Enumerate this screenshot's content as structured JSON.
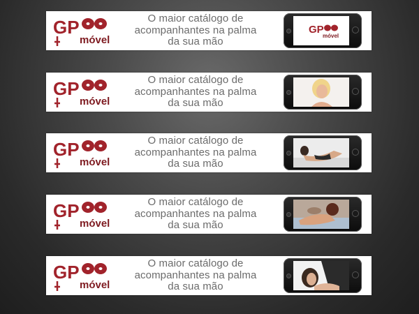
{
  "banners": [
    {
      "brand_top": "GP",
      "brand_bottom": "móvel",
      "tagline_1": "O maior catálogo de",
      "tagline_2": "acompanhantes na palma",
      "tagline_3": "da sua mão",
      "screen": "logo"
    },
    {
      "brand_top": "GP",
      "brand_bottom": "móvel",
      "tagline_1": "O maior catálogo de",
      "tagline_2": "acompanhantes na palma",
      "tagline_3": "da sua mão",
      "screen": "photo"
    },
    {
      "brand_top": "GP",
      "brand_bottom": "móvel",
      "tagline_1": "O maior catálogo de",
      "tagline_2": "acompanhantes na palma",
      "tagline_3": "da sua mão",
      "screen": "photo"
    },
    {
      "brand_top": "GP",
      "brand_bottom": "móvel",
      "tagline_1": "O maior catálogo de",
      "tagline_2": "acompanhantes na palma",
      "tagline_3": "da sua mão",
      "screen": "photo"
    },
    {
      "brand_top": "GP",
      "brand_bottom": "móvel",
      "tagline_1": "O maior catálogo de",
      "tagline_2": "acompanhantes na palma",
      "tagline_3": "da sua mão",
      "screen": "photo"
    }
  ],
  "colors": {
    "brand_red": "#a1232b",
    "brand_dark_red": "#7e1a20",
    "tagline_gray": "#6b6b6b",
    "phone_black": "#111111"
  },
  "icons": [
    "gp-logo-icon",
    "smartphone-icon"
  ]
}
